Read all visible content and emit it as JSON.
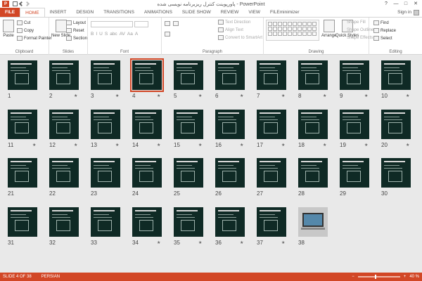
{
  "window": {
    "logo": "P",
    "title": "پاورپوینت کنترل ریزبرنامه نویسی شده - PowerPoint",
    "controls": [
      "?",
      "—",
      "□",
      "✕"
    ]
  },
  "tabs": {
    "items": [
      "FILE",
      "HOME",
      "INSERT",
      "DESIGN",
      "TRANSITIONS",
      "ANIMATIONS",
      "SLIDE SHOW",
      "REVIEW",
      "VIEW",
      "FILEminimizer"
    ],
    "active": "HOME",
    "signin": "Sign in"
  },
  "ribbon": {
    "clipboard": {
      "paste": "Paste",
      "cut": "Cut",
      "copy": "Copy",
      "format_painter": "Format Painter",
      "label": "Clipboard"
    },
    "slides": {
      "new_slide": "New Slide",
      "layout": "Layout",
      "reset": "Reset",
      "section": "Section",
      "label": "Slides"
    },
    "font": {
      "label": "Font",
      "format_buttons": [
        "B",
        "I",
        "U",
        "S",
        "abc",
        "AV",
        "Aa",
        "A"
      ]
    },
    "paragraph": {
      "text_direction": "Text Direction",
      "align_text": "Align Text",
      "smartart": "Convert to SmartArt",
      "label": "Paragraph"
    },
    "drawing": {
      "arrange": "Arrange",
      "quick_styles": "Quick Styles",
      "shape_fill": "Shape Fill",
      "shape_outline": "Shape Outline",
      "shape_effects": "Shape Effects",
      "label": "Drawing"
    },
    "editing": {
      "find": "Find",
      "replace": "Replace",
      "select": "Select",
      "label": "Editing"
    }
  },
  "slides": [
    {
      "num": "1",
      "star": ""
    },
    {
      "num": "2",
      "star": "★"
    },
    {
      "num": "3",
      "star": "★"
    },
    {
      "num": "4",
      "star": "★",
      "selected": true
    },
    {
      "num": "5",
      "star": "★"
    },
    {
      "num": "6",
      "star": "★"
    },
    {
      "num": "7",
      "star": "★"
    },
    {
      "num": "8",
      "star": "★"
    },
    {
      "num": "9",
      "star": "★"
    },
    {
      "num": "10",
      "star": "★"
    },
    {
      "num": "11",
      "star": "★"
    },
    {
      "num": "12",
      "star": "★"
    },
    {
      "num": "13",
      "star": "★"
    },
    {
      "num": "14",
      "star": "★"
    },
    {
      "num": "15",
      "star": "★"
    },
    {
      "num": "16",
      "star": "★"
    },
    {
      "num": "17",
      "star": "★"
    },
    {
      "num": "18",
      "star": "★"
    },
    {
      "num": "19",
      "star": "★"
    },
    {
      "num": "20",
      "star": "★"
    },
    {
      "num": "21",
      "star": ""
    },
    {
      "num": "22",
      "star": ""
    },
    {
      "num": "23",
      "star": ""
    },
    {
      "num": "24",
      "star": ""
    },
    {
      "num": "25",
      "star": ""
    },
    {
      "num": "26",
      "star": ""
    },
    {
      "num": "27",
      "star": ""
    },
    {
      "num": "28",
      "star": ""
    },
    {
      "num": "29",
      "star": ""
    },
    {
      "num": "30",
      "star": ""
    },
    {
      "num": "31",
      "star": ""
    },
    {
      "num": "32",
      "star": ""
    },
    {
      "num": "33",
      "star": ""
    },
    {
      "num": "34",
      "star": "★"
    },
    {
      "num": "35",
      "star": "★"
    },
    {
      "num": "36",
      "star": "★"
    },
    {
      "num": "37",
      "star": "★"
    },
    {
      "num": "38",
      "star": "",
      "photo": true
    }
  ],
  "status": {
    "slide_info": "SLIDE 4 OF 38",
    "language": "PERSIAN",
    "zoom_minus": "−",
    "zoom_plus": "+",
    "zoom": "40 %",
    "zoom_fraction": 0.4
  },
  "colors": {
    "accent": "#d24726",
    "slide_bg": "#0f2a25"
  }
}
